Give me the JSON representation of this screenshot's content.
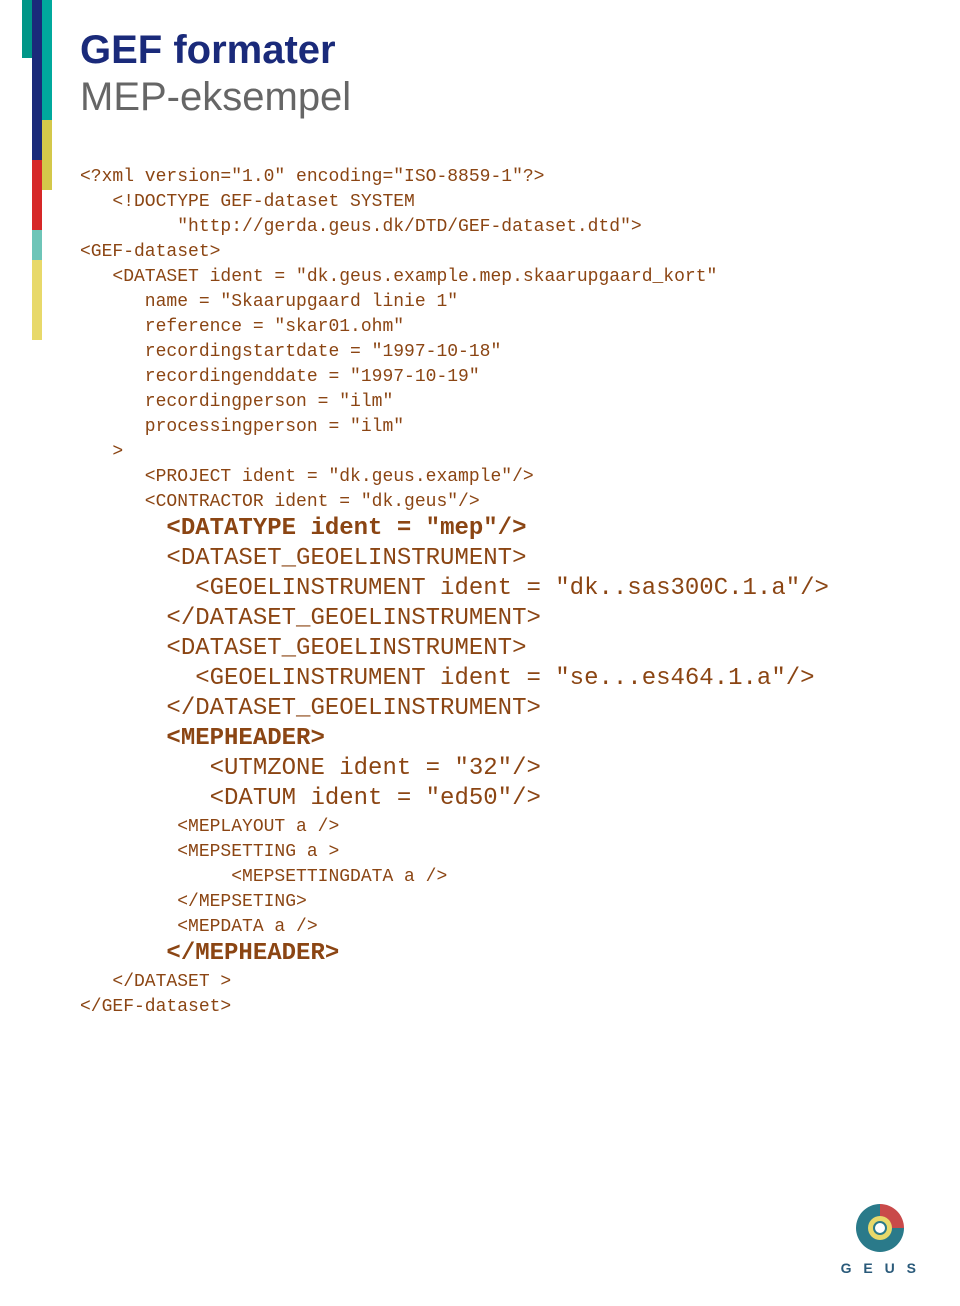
{
  "title": "GEF formater",
  "subtitle": "MEP-eksempel",
  "code": {
    "l1": "<?xml version=\"1.0\" encoding=\"ISO-8859-1\"?>",
    "l2": "   <!DOCTYPE GEF-dataset SYSTEM",
    "l3": "         \"http://gerda.geus.dk/DTD/GEF-dataset.dtd\">",
    "l4": "<GEF-dataset>",
    "l5": "   <DATASET ident = \"dk.geus.example.mep.skaarupgaard_kort\"",
    "l6": "      name = \"Skaarupgaard linie 1\"",
    "l7": "      reference = \"skar01.ohm\"",
    "l8": "      recordingstartdate = \"1997-10-18\"",
    "l9": "      recordingenddate = \"1997-10-19\"",
    "l10": "      recordingperson = \"ilm\"",
    "l11": "      processingperson = \"ilm\"",
    "l12": "   >",
    "l13": "      <PROJECT ident = \"dk.geus.example\"/>",
    "l14": "      <CONTRACTOR ident = \"dk.geus\"/>",
    "l15p1": "      <DATATYPE ident = \"",
    "l15p2": "mep",
    "l15p3": "\"/>",
    "l16": "      <DATASET_GEOELINSTRUMENT>",
    "l17": "        <GEOELINSTRUMENT ident = \"dk..sas300C.1.a\"/>",
    "l18": "      </DATASET_GEOELINSTRUMENT>",
    "l19": "      <DATASET_GEOELINSTRUMENT>",
    "l20": "        <GEOELINSTRUMENT ident = \"se...es464.1.a\"/>",
    "l21": "      </DATASET_GEOELINSTRUMENT>",
    "l22": "      <MEPHEADER>",
    "l23": "         <UTMZONE ident = \"32\"/>",
    "l24": "         <DATUM ident = \"ed50\"/>",
    "l25": "         <MEPLAYOUT a />",
    "l26": "         <MEPSETTING a >",
    "l27": "              <MEPSETTINGDATA a />",
    "l28": "         </MEPSETING>",
    "l29": "         <MEPDATA a />",
    "l30": "      </MEPHEADER>",
    "l31": "   </DATASET >",
    "l32": "</GEF-dataset>"
  },
  "logo": {
    "text": "G E U S"
  }
}
